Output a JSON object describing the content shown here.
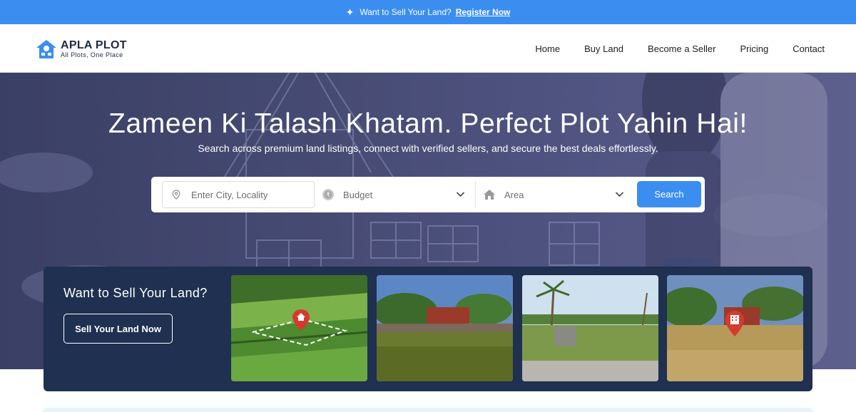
{
  "announcement": {
    "text": "Want to Sell Your Land?",
    "link_label": "Register Now"
  },
  "brand": {
    "name": "APLA PLOT",
    "tagline": "All Plots, One Place",
    "color": "#3b8ef0"
  },
  "nav": {
    "items": [
      {
        "label": "Home"
      },
      {
        "label": "Buy Land"
      },
      {
        "label": "Become a Seller"
      },
      {
        "label": "Pricing"
      },
      {
        "label": "Contact"
      }
    ]
  },
  "hero": {
    "title": "Zameen Ki Talash Khatam. Perfect Plot Yahin Hai!",
    "subtitle": "Search across premium land listings, connect with verified sellers, and secure the best deals effortlessly."
  },
  "search": {
    "location_placeholder": "Enter City, Locality",
    "budget_selected": "Budget",
    "area_selected": "Area",
    "button_label": "Search",
    "icons": {
      "location": "map-pin-icon",
      "budget": "rupee-coin-icon",
      "area": "house-icon",
      "dropdown": "chevron-down-icon"
    }
  },
  "sell_section": {
    "title": "Want to Sell Your Land?",
    "button_label": "Sell Your Land Now",
    "images": [
      {
        "name": "aerial-farmland-plot-image",
        "icon": "home-pin-icon"
      },
      {
        "name": "red-brick-wall-plot-image"
      },
      {
        "name": "palm-tree-grass-plot-image"
      },
      {
        "name": "empty-plot-image",
        "icon": "building-pin-icon"
      }
    ]
  },
  "colors": {
    "accent": "#3b8ef0",
    "panel": "#1f3050",
    "hero_tint": "#454a72"
  }
}
